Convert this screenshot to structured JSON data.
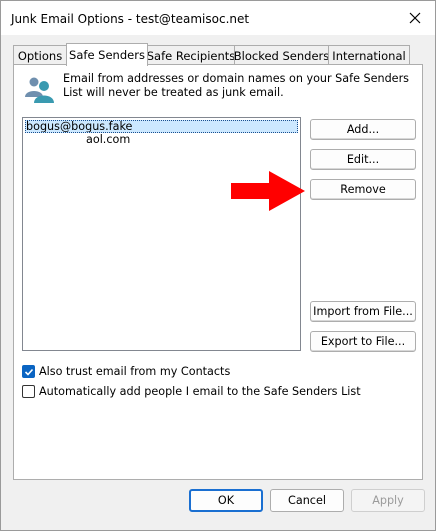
{
  "window": {
    "title": "Junk Email Options - test@teamisoc.net"
  },
  "tabs": [
    {
      "label": "Options",
      "selected": false
    },
    {
      "label": "Safe Senders",
      "selected": true
    },
    {
      "label": "Safe Recipients",
      "selected": false
    },
    {
      "label": "Blocked Senders",
      "selected": false
    },
    {
      "label": "International",
      "selected": false
    }
  ],
  "panel": {
    "description": "Email from addresses or domain names on your Safe Senders List will never be treated as junk email.",
    "senders": [
      "bogus@bogus.fake",
      "aol.com"
    ],
    "buttons": {
      "add": "Add...",
      "edit": "Edit...",
      "remove": "Remove",
      "import": "Import from File...",
      "export": "Export to File..."
    },
    "checkboxes": [
      {
        "label": "Also trust email from my Contacts",
        "checked": true
      },
      {
        "label": "Automatically add people I email to the Safe Senders List",
        "checked": false
      }
    ]
  },
  "footer": {
    "ok": "OK",
    "cancel": "Cancel",
    "apply": "Apply"
  },
  "annotation": {
    "arrow_color": "#ff0000"
  },
  "colors": {
    "accent": "#0a64c2",
    "selection": "#cce8ff"
  }
}
